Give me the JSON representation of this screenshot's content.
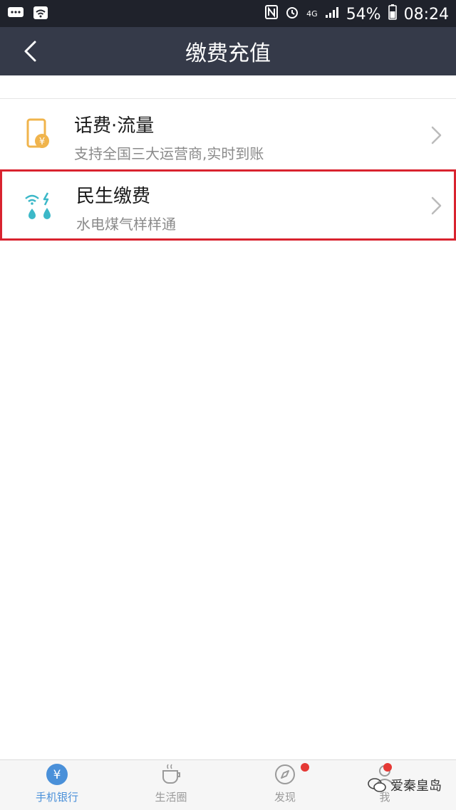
{
  "status_bar": {
    "battery": "54%",
    "time": "08:24",
    "network": "4G"
  },
  "header": {
    "title": "缴费充值"
  },
  "items": [
    {
      "title": "话费·流量",
      "subtitle": "支持全国三大运营商,实时到账",
      "icon": "phone-topup-icon"
    },
    {
      "title": "民生缴费",
      "subtitle": "水电煤气样样通",
      "icon": "utilities-icon"
    }
  ],
  "tabs": [
    {
      "label": "手机银行",
      "icon": "yuan-icon",
      "active": true
    },
    {
      "label": "生活圈",
      "icon": "coffee-cup-icon",
      "active": false
    },
    {
      "label": "发现",
      "icon": "compass-icon",
      "active": false,
      "badge": true
    },
    {
      "label": "我",
      "icon": "user-icon",
      "active": false,
      "badge": true
    }
  ],
  "watermark": {
    "text": "爱秦皇岛"
  },
  "colors": {
    "status_bar_bg": "#1f222b",
    "nav_bar_bg": "#353a49",
    "highlight_border": "#d9232f",
    "badge": "#e53935",
    "active_tab": "#4a90d9"
  }
}
